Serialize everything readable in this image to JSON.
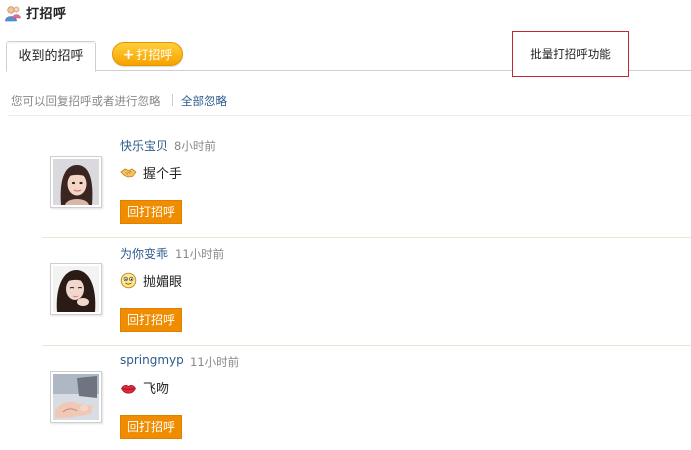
{
  "header": {
    "title": "打招呼",
    "icon": "greeting-people-icon"
  },
  "tabs": [
    {
      "label": "收到的招呼",
      "active": true
    }
  ],
  "greet_button": {
    "label": "打招呼",
    "icon": "plus-icon"
  },
  "batch_feature": {
    "label": "批量打招呼功能"
  },
  "hint": {
    "text": "您可以回复招呼或者进行忽略",
    "ignore_all": "全部忽略"
  },
  "greetings": [
    {
      "name": "快乐宝贝",
      "time": "8小时前",
      "icon": "handshake-icon",
      "message": "握个手",
      "reply_label": "回打招呼",
      "avatar": "user-avatar"
    },
    {
      "name": "为你变乖",
      "time": "11小时前",
      "icon": "wink-face-icon",
      "message": "抛媚眼",
      "reply_label": "回打招呼",
      "avatar": "user-avatar"
    },
    {
      "name": "springmyp",
      "time": "11小时前",
      "icon": "kiss-lips-icon",
      "message": "飞吻",
      "reply_label": "回打招呼",
      "avatar": "user-avatar"
    }
  ],
  "colors": {
    "accent_orange": "#f08c00",
    "link_blue": "#2d5b8a",
    "highlight_border": "#c0292f"
  }
}
